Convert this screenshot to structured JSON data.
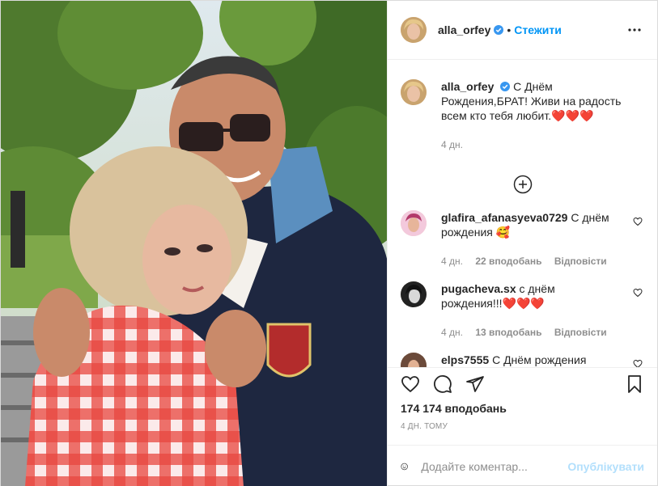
{
  "post": {
    "author": "alla_orfey",
    "follow_label": "Стежити",
    "dot": "•"
  },
  "caption": {
    "username": "alla_orfey",
    "text": "С Днём Рождения,БРАТ! Живи на радость всем кто тебя любит.",
    "hearts": "❤️❤️❤️",
    "age": "4 дн."
  },
  "comments": [
    {
      "username": "glafira_afanasyeva0729",
      "text": "С днём рождения",
      "emoji": "🥰",
      "age": "4 дн.",
      "likes": "22 вподобань",
      "reply": "Відповісти"
    },
    {
      "username": "pugacheva.sx",
      "text": "с днём рождения!!!",
      "emoji": "❤️❤️❤️",
      "age": "4 дн.",
      "likes": "13 вподобань",
      "reply": "Відповісти"
    },
    {
      "username": "elps7555",
      "text": "С Днём рождения"
    }
  ],
  "stats": {
    "likes": "174 174 вподобань",
    "time": "4 дн. тому"
  },
  "add_comment": {
    "placeholder": "Додайте коментар...",
    "publish": "Опублікувати"
  },
  "colors": {
    "accent": "#0095f6",
    "publish_disabled": "#b2dffc",
    "heart": "#e0245e",
    "verified": "#3897f0"
  }
}
